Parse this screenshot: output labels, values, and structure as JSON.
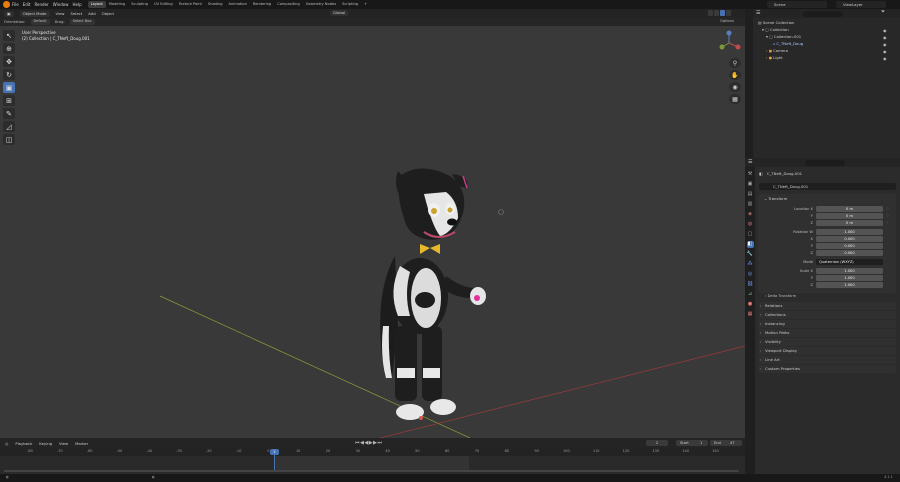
{
  "topbar": {
    "menus": [
      "File",
      "Edit",
      "Render",
      "Window",
      "Help"
    ],
    "workspaces": [
      "Layout",
      "Modeling",
      "Sculpting",
      "UV Editing",
      "Texture Paint",
      "Shading",
      "Animation",
      "Rendering",
      "Compositing",
      "Geometry Nodes",
      "Scripting",
      "+"
    ],
    "active_workspace": "Layout",
    "scene": "Scene",
    "view_layer": "ViewLayer"
  },
  "viewport_header": {
    "mode": "Object Mode",
    "menus": [
      "View",
      "Select",
      "Add",
      "Object"
    ],
    "orientation_label": "Orientation:",
    "orientation_value": "Default",
    "drag_label": "Drag:",
    "drag_value": "Select Box",
    "transform_orientation": "Global",
    "options": "Options"
  },
  "viewport": {
    "perspective": "User Perspective",
    "context": "(2) Collection | C_TNeft_Doug.001"
  },
  "timeline": {
    "menus": [
      "Playback",
      "Keying",
      "View",
      "Marker"
    ],
    "current_frame": "2",
    "start_label": "Start",
    "start": "1",
    "end_label": "End",
    "end": "47",
    "ticks": [
      "-80",
      "-70",
      "-60",
      "-50",
      "-40",
      "-30",
      "-20",
      "-10",
      "0",
      "10",
      "20",
      "30",
      "40",
      "50",
      "60",
      "70",
      "80",
      "90",
      "100",
      "110",
      "120",
      "130",
      "140",
      "150"
    ],
    "playhead": "2"
  },
  "status": {
    "version": "4.1.1"
  },
  "outliner": {
    "root": "Scene Collection",
    "rows": [
      {
        "label": "Collection",
        "indent": 1
      },
      {
        "label": "Collection.001",
        "indent": 2
      },
      {
        "label": "C_TNeft_Doug",
        "indent": 3
      },
      {
        "label": "Camera",
        "indent": 2
      },
      {
        "label": "Light",
        "indent": 2
      }
    ]
  },
  "properties": {
    "object_name": "C_TNeft_Doug.001",
    "object_field": "C_TNeft_Doug.001",
    "transform_title": "Transform",
    "fields": [
      {
        "label": "Location X",
        "value": "0 m"
      },
      {
        "label": "Y",
        "value": "0 m"
      },
      {
        "label": "Z",
        "value": "0 m"
      },
      {
        "label": "Rotation W",
        "value": "1.000"
      },
      {
        "label": "X",
        "value": "0.000"
      },
      {
        "label": "Y",
        "value": "0.000"
      },
      {
        "label": "Z",
        "value": "0.000"
      },
      {
        "label": "Mode",
        "value": "Quaternion (WXYZ)"
      },
      {
        "label": "Scale X",
        "value": "1.000"
      },
      {
        "label": "Y",
        "value": "1.000"
      },
      {
        "label": "Z",
        "value": "1.000"
      }
    ],
    "delta": "Delta Transform",
    "sections": [
      "Relations",
      "Collections",
      "Instancing",
      "Motion Paths",
      "Visibility",
      "Viewport Display",
      "Line Art",
      "Custom Properties"
    ]
  },
  "colors": {
    "accent": "#4772b3",
    "viewport_bg": "#393939",
    "panel_bg": "#2b2b2b"
  }
}
